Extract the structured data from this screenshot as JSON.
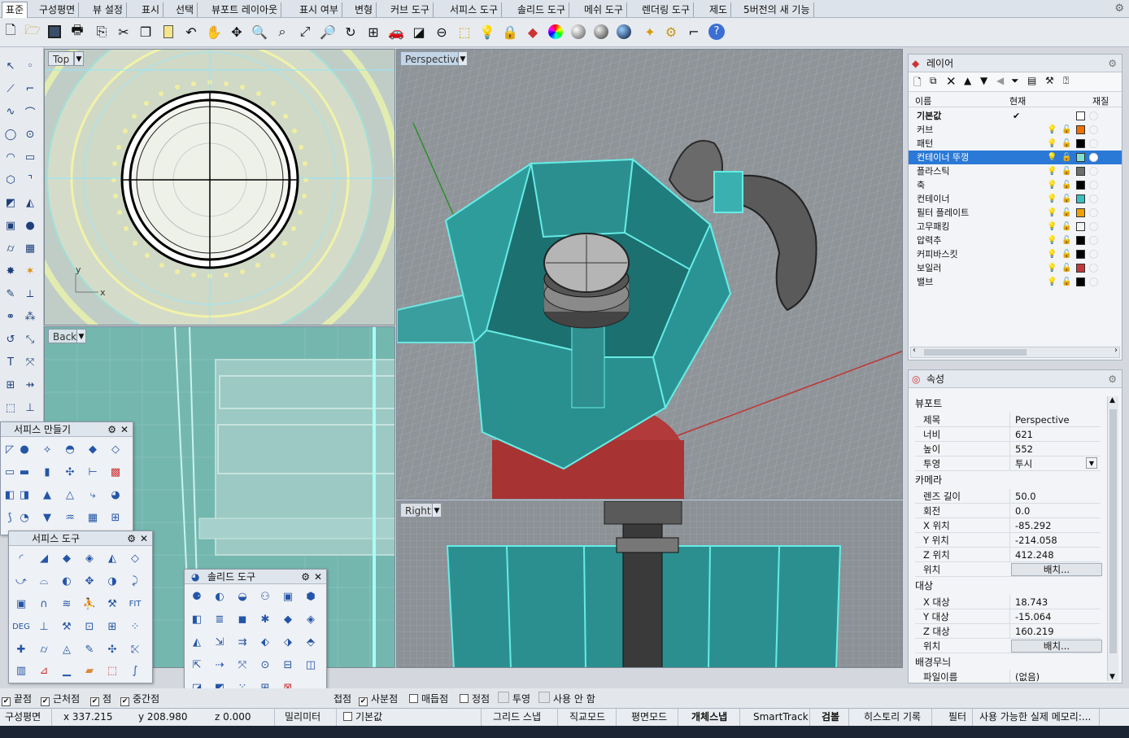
{
  "tabs": [
    "표준",
    "구성평면",
    "뷰 설정",
    "표시",
    "선택",
    "뷰포트 레이아웃",
    "표시 여부",
    "변형",
    "커브 도구",
    "서피스 도구",
    "솔리드 도구",
    "메쉬 도구",
    "렌더링 도구",
    "제도",
    "5버전의 새 기능"
  ],
  "toolbar_icons": [
    "new-icon",
    "open-icon",
    "save-icon",
    "print-icon",
    "import-icon",
    "cut-icon",
    "copy-icon",
    "paste-icon",
    "undo-icon",
    "pan-icon",
    "move-view-icon",
    "zoom-icon",
    "zoom-window-icon",
    "zoom-extents-icon",
    "zoom-selected-icon",
    "rotate-view-icon",
    "four-views-icon",
    "car-icon",
    "render-scene-icon",
    "cplane-icon",
    "select-points-icon",
    "light-icon",
    "lock-icon",
    "layer-icon",
    "color-wheel-icon",
    "shade-icon",
    "render-preview-icon",
    "render-icon",
    "sun-icon",
    "options-gear-icon",
    "dimension-icon",
    "help-icon"
  ],
  "viewports": {
    "top": {
      "label": "Top",
      "axis_y": "y",
      "axis_x": "x"
    },
    "back": {
      "label": "Back",
      "partial_tab": "ack"
    },
    "perspective": {
      "label": "Perspective"
    },
    "right": {
      "label": "Right"
    }
  },
  "layers_panel": {
    "title": "레이어",
    "col_name": "이름",
    "col_current": "현재",
    "col_material": "재질",
    "rows": [
      {
        "name": "기본값",
        "current": "✔",
        "color": "#ffffff"
      },
      {
        "name": "커브",
        "current": "",
        "color": "#f07000"
      },
      {
        "name": "패턴",
        "current": "",
        "color": "#000000"
      },
      {
        "name": "컨테이너 뚜껑",
        "current": "",
        "color": "#7fe0d0",
        "selected": true
      },
      {
        "name": "플라스틱",
        "current": "",
        "color": "#6e6e6e"
      },
      {
        "name": "축",
        "current": "",
        "color": "#000000"
      },
      {
        "name": "컨테이너",
        "current": "",
        "color": "#3bbfbf"
      },
      {
        "name": "필터 플레이트",
        "current": "",
        "color": "#f0a000"
      },
      {
        "name": "고무패킹",
        "current": "",
        "color": "#f4f4f4"
      },
      {
        "name": "압력추",
        "current": "",
        "color": "#000000"
      },
      {
        "name": "커피바스킷",
        "current": "",
        "color": "#000000"
      },
      {
        "name": "보일러",
        "current": "",
        "color": "#c0393b"
      },
      {
        "name": "밸브",
        "current": "",
        "color": "#000000"
      }
    ]
  },
  "properties_panel": {
    "title": "속성",
    "section_viewport": "뷰포트",
    "title_label": "제목",
    "title_value": "Perspective",
    "width_label": "너비",
    "width_value": "621",
    "height_label": "높이",
    "height_value": "552",
    "projection_label": "투영",
    "projection_value": "투시",
    "section_camera": "카메라",
    "lens_label": "렌즈 길이",
    "lens_value": "50.0",
    "rotation_label": "회전",
    "rotation_value": "0.0",
    "xpos_label": "X 위치",
    "xpos_value": "-85.292",
    "ypos_label": "Y 위치",
    "ypos_value": "-214.058",
    "zpos_label": "Z 위치",
    "zpos_value": "412.248",
    "position_label": "위치",
    "place_button": "배치...",
    "section_target": "대상",
    "xtgt_label": "X 대상",
    "xtgt_value": "18.743",
    "ytgt_label": "Y 대상",
    "ytgt_value": "-15.064",
    "ztgt_label": "Z 대상",
    "ztgt_value": "160.219",
    "tposition_label": "위치",
    "tplace_button": "배치...",
    "section_bg": "배경무늬",
    "file_label": "파일이름",
    "file_value": "(없음)"
  },
  "float_panels": {
    "surface_create": "서피스 만들기",
    "surface_tools": "서피스 도구",
    "solid_tools": "솔리드 도구"
  },
  "osnaps": [
    {
      "label": "끝점",
      "checked": true
    },
    {
      "label": "근처점",
      "checked": true
    },
    {
      "label": "점",
      "checked": true
    },
    {
      "label": "중간점",
      "checked": true
    },
    {
      "label": "접점",
      "checked": false
    },
    {
      "label": "사분점",
      "checked": true
    },
    {
      "label": "매듭점",
      "checked": false
    },
    {
      "label": "정점",
      "checked": false
    },
    {
      "label": "투영",
      "checked": false
    },
    {
      "label": "사용 안 함",
      "checked": false
    }
  ],
  "status": {
    "cplane": "구성평면",
    "x": "x 337.215",
    "y": "y 208.980",
    "z": "z 0.000",
    "units": "밀리미터",
    "layer": "기본값",
    "grid_snap": "그리드 스냅",
    "ortho": "직교모드",
    "planar": "평면모드",
    "osnap": "개체스냅",
    "smarttrack": "SmartTrack",
    "gumball": "검볼",
    "history": "히스토리 기록",
    "filter": "필터",
    "memory": "사용 가능한 실제 메모리:..."
  }
}
